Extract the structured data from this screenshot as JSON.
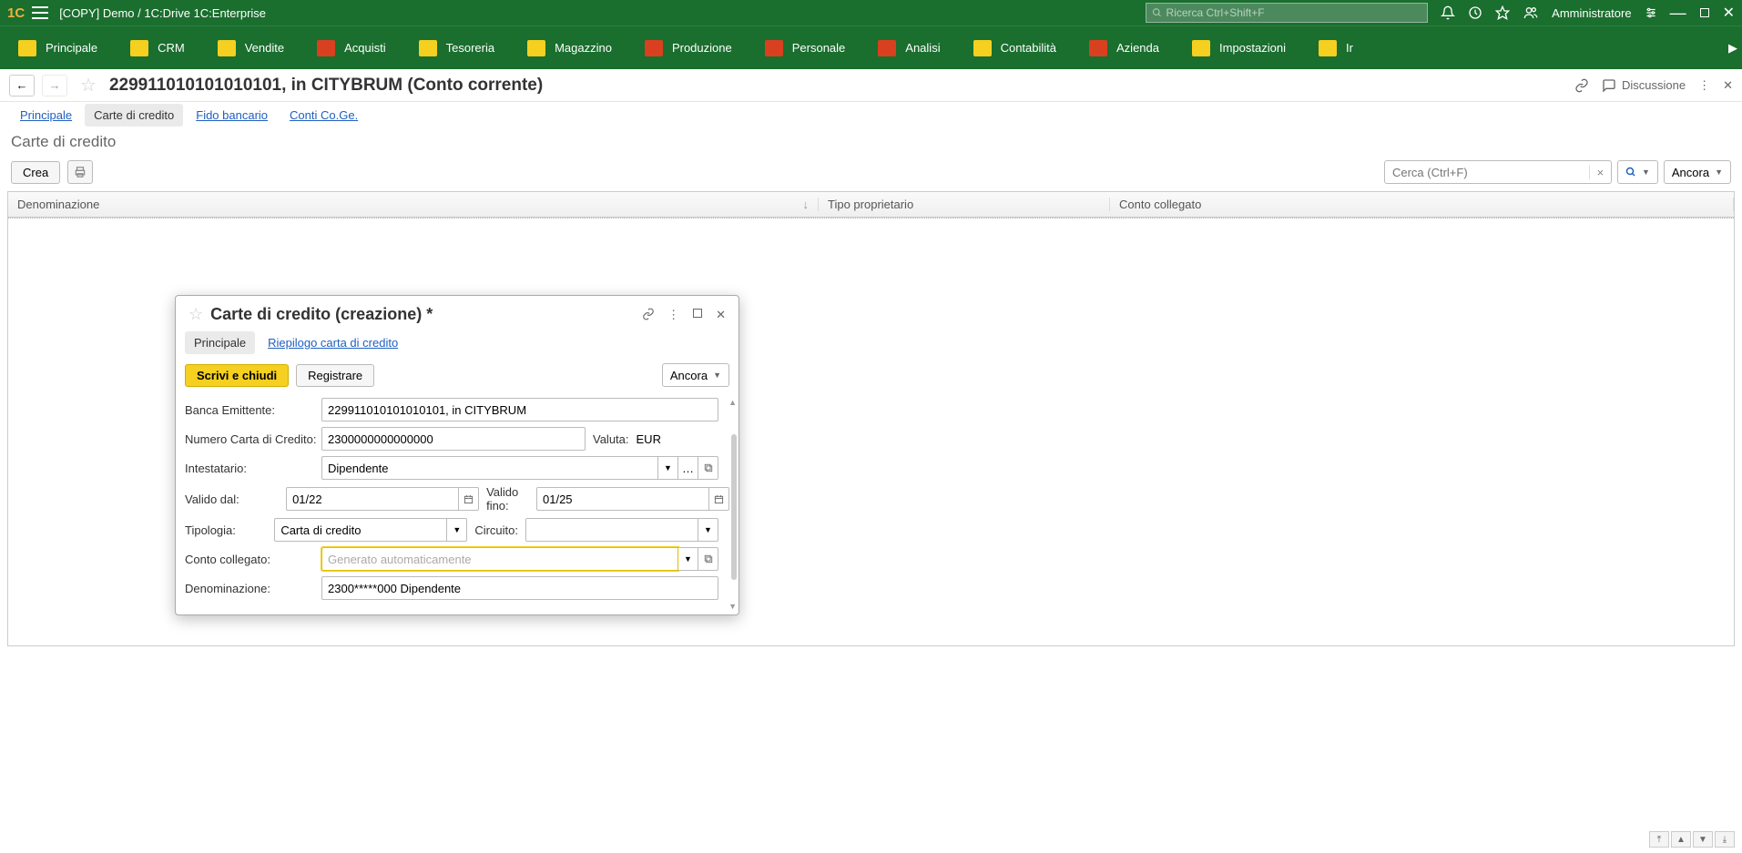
{
  "topbar": {
    "title": "[COPY] Demo / 1C:Drive 1C:Enterprise",
    "search_placeholder": "Ricerca Ctrl+Shift+F",
    "user": "Amministratore"
  },
  "nav": {
    "items": [
      {
        "label": "Principale"
      },
      {
        "label": "CRM"
      },
      {
        "label": "Vendite"
      },
      {
        "label": "Acquisti"
      },
      {
        "label": "Tesoreria"
      },
      {
        "label": "Magazzino"
      },
      {
        "label": "Produzione"
      },
      {
        "label": "Personale"
      },
      {
        "label": "Analisi"
      },
      {
        "label": "Contabilità"
      },
      {
        "label": "Azienda"
      },
      {
        "label": "Impostazioni"
      },
      {
        "label": "Ir"
      }
    ]
  },
  "page": {
    "title": "229911010101010101, in CITYBRUM (Conto corrente)",
    "discuss": "Discussione",
    "tabs": [
      {
        "label": "Principale"
      },
      {
        "label": "Carte di credito"
      },
      {
        "label": "Fido bancario"
      },
      {
        "label": "Conti Co.Ge."
      }
    ],
    "section_title": "Carte di credito"
  },
  "actions": {
    "create": "Crea",
    "search_placeholder": "Cerca (Ctrl+F)",
    "more": "Ancora"
  },
  "table": {
    "columns": [
      {
        "label": "Denominazione"
      },
      {
        "label": "Tipo proprietario"
      },
      {
        "label": "Conto collegato"
      }
    ]
  },
  "dialog": {
    "title": "Carte di credito (creazione) *",
    "tabs": [
      {
        "label": "Principale"
      },
      {
        "label": "Riepilogo carta di credito"
      }
    ],
    "save_close": "Scrivi e chiudi",
    "save": "Registrare",
    "more": "Ancora",
    "fields": {
      "bank_label": "Banca Emittente:",
      "bank_value": "229911010101010101, in CITYBRUM",
      "cardnum_label": "Numero Carta di Credito:",
      "cardnum_value": "2300000000000000",
      "currency_label": "Valuta:",
      "currency_value": "EUR",
      "holder_label": "Intestatario:",
      "holder_value": "Dipendente",
      "validfrom_label": "Valido dal:",
      "validfrom_value": "01/22",
      "validto_label": "Valido fino:",
      "validto_value": "01/25",
      "type_label": "Tipologia:",
      "type_value": "Carta di credito",
      "circuit_label": "Circuito:",
      "circuit_value": "",
      "account_label": "Conto collegato:",
      "account_placeholder": "Generato automaticamente",
      "name_label": "Denominazione:",
      "name_value": "2300*****000 Dipendente"
    }
  }
}
